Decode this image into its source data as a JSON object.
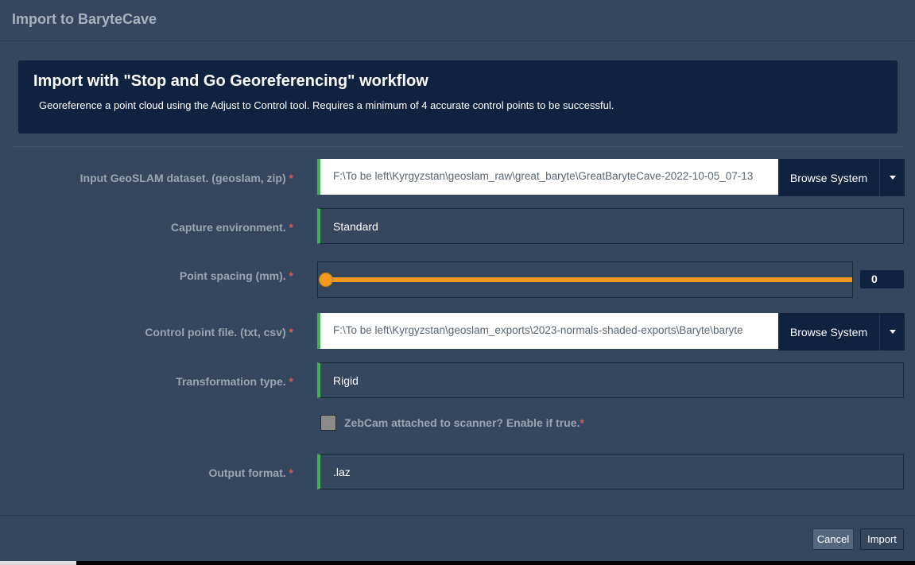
{
  "dialog": {
    "title": "Import to BaryteCave"
  },
  "banner": {
    "heading": "Import with \"Stop and Go Georeferencing\" workflow",
    "description": "Georeference a point cloud using the Adjust to Control tool. Requires a minimum of 4 accurate control points to be successful."
  },
  "form": {
    "required_marker": "*",
    "input_dataset": {
      "label": "Input GeoSLAM dataset. (geoslam, zip)",
      "value": "F:\\To be left\\Kyrgyzstan\\geoslam_raw\\great_baryte\\GreatBaryteCave-2022-10-05_07-13",
      "browse_label": "Browse System"
    },
    "capture_environment": {
      "label": "Capture environment.",
      "value": "Standard"
    },
    "point_spacing": {
      "label": "Point spacing (mm).",
      "value": "0",
      "slider_fraction": 0.0
    },
    "control_point_file": {
      "label": "Control point file. (txt, csv)",
      "value": "F:\\To be left\\Kyrgyzstan\\geoslam_exports\\2023-normals-shaded-exports\\Baryte\\baryte",
      "browse_label": "Browse System"
    },
    "transformation_type": {
      "label": "Transformation type.",
      "value": "Rigid"
    },
    "zebcam": {
      "label": "ZebCam attached to scanner? Enable if true.",
      "checked": false
    },
    "output_format": {
      "label": "Output format.",
      "value": ".laz"
    }
  },
  "footer": {
    "cancel_label": "Cancel",
    "import_label": "Import"
  },
  "colors": {
    "background": "#34475e",
    "banner": "#0f2340",
    "accent_valid": "#3fb34f",
    "slider": "#f39a1e",
    "required": "#e05a5a"
  }
}
